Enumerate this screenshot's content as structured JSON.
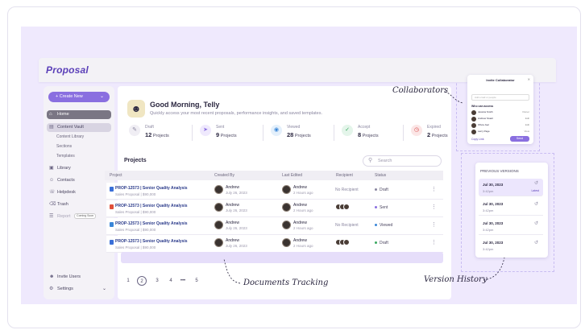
{
  "app": {
    "logo": "Proposal"
  },
  "sidebar": {
    "create_label": "+ Create New",
    "items": [
      {
        "label": "Home",
        "icon": "home-icon"
      },
      {
        "label": "Content Vault",
        "icon": "vault-icon"
      },
      {
        "label": "Library",
        "icon": "library-icon"
      },
      {
        "label": "Contacts",
        "icon": "contacts-icon"
      },
      {
        "label": "Helpdesk",
        "icon": "headset-icon"
      },
      {
        "label": "Trash",
        "icon": "trash-icon"
      },
      {
        "label": "Report",
        "icon": "report-icon"
      }
    ],
    "sub_items": [
      "Content Library",
      "Sections",
      "Templates"
    ],
    "report_badge": "Coming Soon",
    "bottom": [
      {
        "label": "Invite Users",
        "icon": "invite-icon"
      },
      {
        "label": "Settings",
        "icon": "gear-icon"
      }
    ]
  },
  "greeting": {
    "title": "Good Morning, Telly",
    "subtitle": "Quickly access your most recent proposals, performance insights, and saved templates."
  },
  "stats": [
    {
      "label": "Draft",
      "count": "12",
      "unit": "Projects",
      "icon": "pencil-icon",
      "color": "#8a86a0"
    },
    {
      "label": "Sent",
      "count": "9",
      "unit": "Projects",
      "icon": "send-icon",
      "color": "#8a6fe0"
    },
    {
      "label": "Viewed",
      "count": "28",
      "unit": "Projects",
      "icon": "eye-icon",
      "color": "#3a86d8"
    },
    {
      "label": "Accept",
      "count": "8",
      "unit": "Projects",
      "icon": "check-icon",
      "color": "#3aa860"
    },
    {
      "label": "Expired",
      "count": "2",
      "unit": "Projects",
      "icon": "clock-icon",
      "color": "#d84a4a"
    }
  ],
  "projects": {
    "title": "Projects",
    "search_placeholder": "Search",
    "columns": [
      "Project",
      "Created By",
      "Last Edited",
      "Recipient",
      "Status"
    ],
    "rows": [
      {
        "title": "PROP-12573 | Senior Quality Analysis",
        "sub": "Sales Proposal | $90,000",
        "doc_color": "#3a6fd8",
        "creator": "Andrew",
        "created": "July 26, 2023",
        "editor": "Andrew",
        "edited": "2 Hours ago",
        "recipient": "No Recipient",
        "recipient_avatars": 0,
        "status": "Draft",
        "status_color": "#8a86a0"
      },
      {
        "title": "PROP-12573 | Senior Quality Analysis",
        "sub": "Sales Proposal | $90,000",
        "doc_color": "#e0503a",
        "creator": "Andrew",
        "created": "July 26, 2023",
        "editor": "Andrew",
        "edited": "2 Hours ago",
        "recipient": "",
        "recipient_avatars": 3,
        "status": "Sent",
        "status_color": "#8a6fe0"
      },
      {
        "title": "PROP-12573 | Senior Quality Analysis",
        "sub": "Sales Proposal | $90,000",
        "doc_color": "#3a86d8",
        "creator": "Andrew",
        "created": "July 26, 2023",
        "editor": "Andrew",
        "edited": "2 Hours ago",
        "recipient": "No Recipient",
        "recipient_avatars": 0,
        "status": "Viewed",
        "status_color": "#3a86d8"
      },
      {
        "title": "PROP-12573 | Senior Quality Analysis",
        "sub": "Sales Proposal | $90,000",
        "doc_color": "#3a6fd8",
        "creator": "Andrew",
        "created": "July 26, 2023",
        "editor": "Andrew",
        "edited": "2 Hours ago",
        "recipient": "",
        "recipient_avatars": 3,
        "status": "Draft",
        "status_color": "#3aa860"
      }
    ],
    "pagination": [
      "1",
      "2",
      "3",
      "4",
      "•••",
      "5"
    ],
    "current_page": "2"
  },
  "collaborators": {
    "title": "Invite Collaborator",
    "input_placeholder": "Add email or people",
    "heading": "Who can access",
    "people": [
      {
        "name": "Jessica Smith",
        "role": "Owner"
      },
      {
        "name": "Andrew Stuart",
        "role": "Edit"
      },
      {
        "name": "Olivia Joel",
        "role": "Edit"
      },
      {
        "name": "Larry Page",
        "role": "View"
      }
    ],
    "copy_link": "Copy Link",
    "send_label": "Send"
  },
  "version_history": {
    "title": "PREVIOUS VERSIONS",
    "versions": [
      {
        "date": "Jul 30, 2023",
        "time": "3:42pm",
        "label": "Latest"
      },
      {
        "date": "Jul 30, 2023",
        "time": "3:42pm",
        "label": ""
      },
      {
        "date": "Jul 30, 2023",
        "time": "3:42pm",
        "label": ""
      },
      {
        "date": "Jul 30, 2023",
        "time": "3:42pm",
        "label": ""
      }
    ]
  },
  "callouts": {
    "collaborators": "Collaborators",
    "documents_tracking": "Documents Tracking",
    "version_history": "Version History"
  },
  "colors": {
    "accent": "#8a6fe0",
    "brand": "#5a3fb8",
    "canvas": "#efe9fd"
  }
}
